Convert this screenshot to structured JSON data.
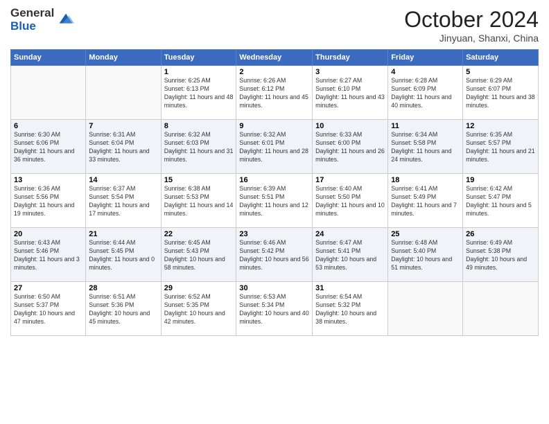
{
  "header": {
    "logo_line1": "General",
    "logo_line2": "Blue",
    "month": "October 2024",
    "location": "Jinyuan, Shanxi, China"
  },
  "days_of_week": [
    "Sunday",
    "Monday",
    "Tuesday",
    "Wednesday",
    "Thursday",
    "Friday",
    "Saturday"
  ],
  "weeks": [
    [
      {
        "num": "",
        "info": ""
      },
      {
        "num": "",
        "info": ""
      },
      {
        "num": "1",
        "info": "Sunrise: 6:25 AM\nSunset: 6:13 PM\nDaylight: 11 hours and 48 minutes."
      },
      {
        "num": "2",
        "info": "Sunrise: 6:26 AM\nSunset: 6:12 PM\nDaylight: 11 hours and 45 minutes."
      },
      {
        "num": "3",
        "info": "Sunrise: 6:27 AM\nSunset: 6:10 PM\nDaylight: 11 hours and 43 minutes."
      },
      {
        "num": "4",
        "info": "Sunrise: 6:28 AM\nSunset: 6:09 PM\nDaylight: 11 hours and 40 minutes."
      },
      {
        "num": "5",
        "info": "Sunrise: 6:29 AM\nSunset: 6:07 PM\nDaylight: 11 hours and 38 minutes."
      }
    ],
    [
      {
        "num": "6",
        "info": "Sunrise: 6:30 AM\nSunset: 6:06 PM\nDaylight: 11 hours and 36 minutes."
      },
      {
        "num": "7",
        "info": "Sunrise: 6:31 AM\nSunset: 6:04 PM\nDaylight: 11 hours and 33 minutes."
      },
      {
        "num": "8",
        "info": "Sunrise: 6:32 AM\nSunset: 6:03 PM\nDaylight: 11 hours and 31 minutes."
      },
      {
        "num": "9",
        "info": "Sunrise: 6:32 AM\nSunset: 6:01 PM\nDaylight: 11 hours and 28 minutes."
      },
      {
        "num": "10",
        "info": "Sunrise: 6:33 AM\nSunset: 6:00 PM\nDaylight: 11 hours and 26 minutes."
      },
      {
        "num": "11",
        "info": "Sunrise: 6:34 AM\nSunset: 5:58 PM\nDaylight: 11 hours and 24 minutes."
      },
      {
        "num": "12",
        "info": "Sunrise: 6:35 AM\nSunset: 5:57 PM\nDaylight: 11 hours and 21 minutes."
      }
    ],
    [
      {
        "num": "13",
        "info": "Sunrise: 6:36 AM\nSunset: 5:56 PM\nDaylight: 11 hours and 19 minutes."
      },
      {
        "num": "14",
        "info": "Sunrise: 6:37 AM\nSunset: 5:54 PM\nDaylight: 11 hours and 17 minutes."
      },
      {
        "num": "15",
        "info": "Sunrise: 6:38 AM\nSunset: 5:53 PM\nDaylight: 11 hours and 14 minutes."
      },
      {
        "num": "16",
        "info": "Sunrise: 6:39 AM\nSunset: 5:51 PM\nDaylight: 11 hours and 12 minutes."
      },
      {
        "num": "17",
        "info": "Sunrise: 6:40 AM\nSunset: 5:50 PM\nDaylight: 11 hours and 10 minutes."
      },
      {
        "num": "18",
        "info": "Sunrise: 6:41 AM\nSunset: 5:49 PM\nDaylight: 11 hours and 7 minutes."
      },
      {
        "num": "19",
        "info": "Sunrise: 6:42 AM\nSunset: 5:47 PM\nDaylight: 11 hours and 5 minutes."
      }
    ],
    [
      {
        "num": "20",
        "info": "Sunrise: 6:43 AM\nSunset: 5:46 PM\nDaylight: 11 hours and 3 minutes."
      },
      {
        "num": "21",
        "info": "Sunrise: 6:44 AM\nSunset: 5:45 PM\nDaylight: 11 hours and 0 minutes."
      },
      {
        "num": "22",
        "info": "Sunrise: 6:45 AM\nSunset: 5:43 PM\nDaylight: 10 hours and 58 minutes."
      },
      {
        "num": "23",
        "info": "Sunrise: 6:46 AM\nSunset: 5:42 PM\nDaylight: 10 hours and 56 minutes."
      },
      {
        "num": "24",
        "info": "Sunrise: 6:47 AM\nSunset: 5:41 PM\nDaylight: 10 hours and 53 minutes."
      },
      {
        "num": "25",
        "info": "Sunrise: 6:48 AM\nSunset: 5:40 PM\nDaylight: 10 hours and 51 minutes."
      },
      {
        "num": "26",
        "info": "Sunrise: 6:49 AM\nSunset: 5:38 PM\nDaylight: 10 hours and 49 minutes."
      }
    ],
    [
      {
        "num": "27",
        "info": "Sunrise: 6:50 AM\nSunset: 5:37 PM\nDaylight: 10 hours and 47 minutes."
      },
      {
        "num": "28",
        "info": "Sunrise: 6:51 AM\nSunset: 5:36 PM\nDaylight: 10 hours and 45 minutes."
      },
      {
        "num": "29",
        "info": "Sunrise: 6:52 AM\nSunset: 5:35 PM\nDaylight: 10 hours and 42 minutes."
      },
      {
        "num": "30",
        "info": "Sunrise: 6:53 AM\nSunset: 5:34 PM\nDaylight: 10 hours and 40 minutes."
      },
      {
        "num": "31",
        "info": "Sunrise: 6:54 AM\nSunset: 5:32 PM\nDaylight: 10 hours and 38 minutes."
      },
      {
        "num": "",
        "info": ""
      },
      {
        "num": "",
        "info": ""
      }
    ]
  ]
}
